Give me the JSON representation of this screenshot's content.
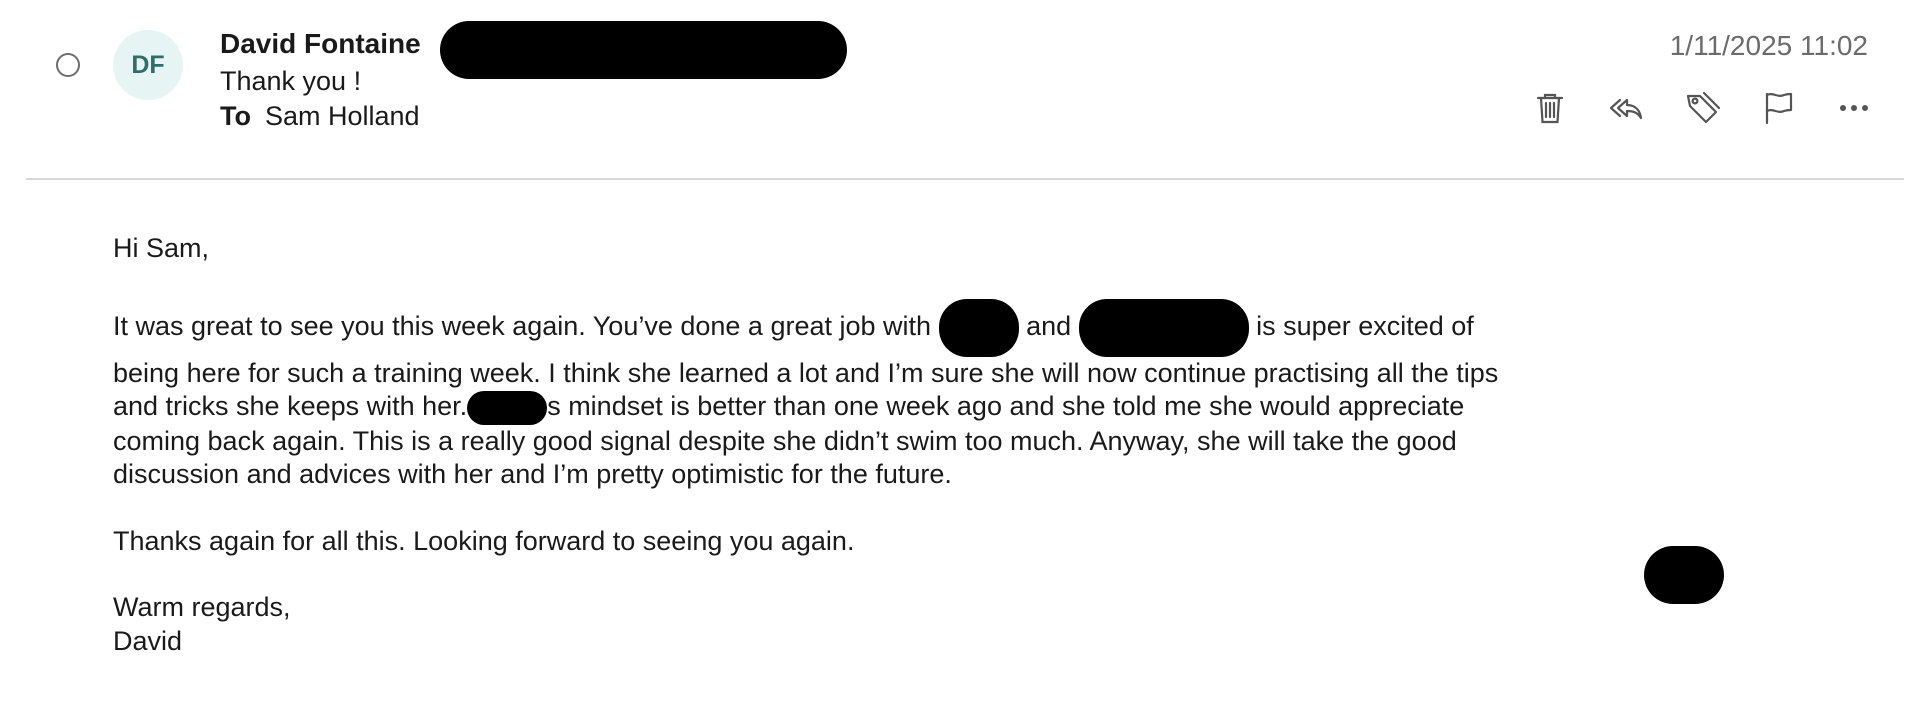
{
  "email": {
    "avatar_initials": "DF",
    "sender_name": "David Fontaine",
    "subject": "Thank you !",
    "to_label": "To",
    "to_name": "Sam Holland",
    "timestamp": "1/11/2025 11:02"
  },
  "toolbar": {
    "icons": [
      "trash-icon",
      "reply-all-icon",
      "tag-icon",
      "flag-icon",
      "more-icon"
    ]
  },
  "body": {
    "greeting": "Hi Sam,",
    "p1_seg1": "It was great to see you this week again.  You’ve done a great job with",
    "p1_seg2": "and",
    "p1_seg3": "is super excited of being here for such a training week.  I think she learned a lot and I’m sure she will now continue practising all the tips and tricks she keeps with her.",
    "p1_seg4": "s mindset is better than one week ago and she told me she would appreciate coming back again.  This is a really good signal despite she didn’t swim too much. Anyway, she will take the good discussion and advices with her and I’m pretty optimistic for the future.",
    "p2": "Thanks again for all this. Looking forward to seeing you again.",
    "closing": "Warm regards,",
    "signature": "David"
  },
  "colors": {
    "avatar_bg": "#e6f5f3",
    "avatar_text": "#2f6e6a",
    "timestamp": "#6b6b6b",
    "divider": "#d7d7d7",
    "redaction": "#000000"
  }
}
